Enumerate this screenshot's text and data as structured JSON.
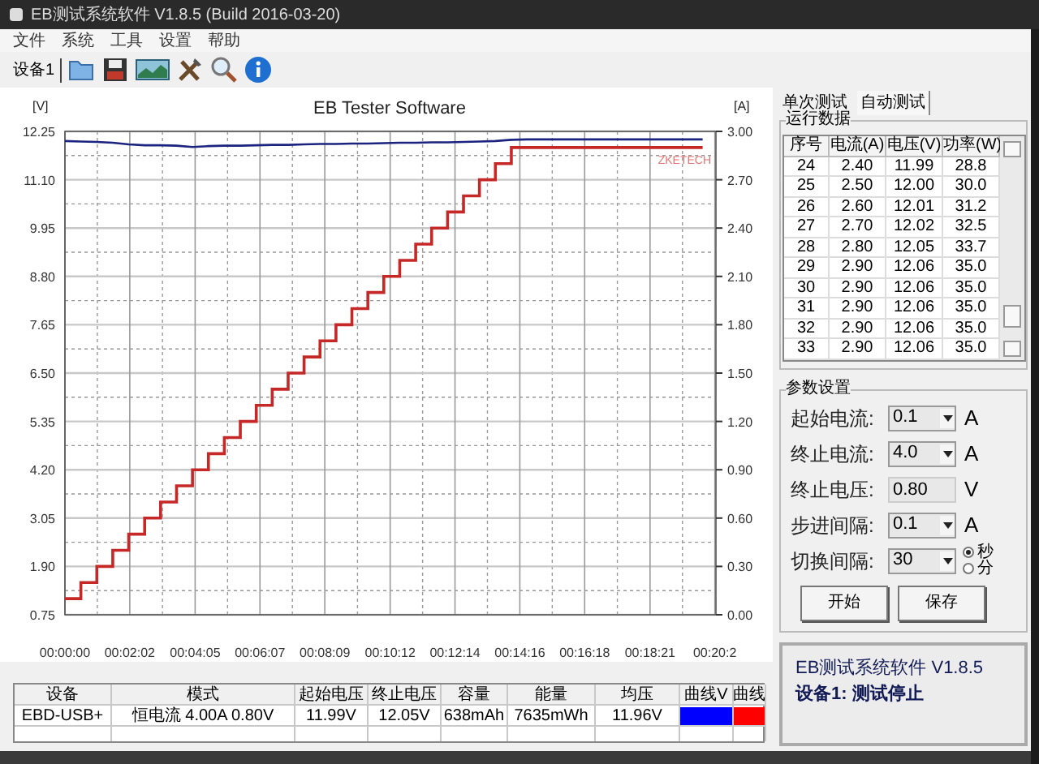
{
  "window": {
    "title": "EB测试系统软件 V1.8.5 (Build 2016-03-20)"
  },
  "menu": [
    "文件",
    "系统",
    "工具",
    "设置",
    "帮助"
  ],
  "toolbar": {
    "device_label": "设备1"
  },
  "chart": {
    "chart_data": {
      "type": "line",
      "title": "EB Tester Software",
      "ylabel": "[V]",
      "y2label": "[A]",
      "grid": true,
      "xlim": [
        0,
        1225
      ],
      "ylim": [
        0.75,
        12.25
      ],
      "y2lim": [
        0,
        3
      ],
      "x": [
        0,
        30,
        30,
        60,
        60,
        90,
        90,
        120,
        120,
        150,
        150,
        180,
        180,
        210,
        210,
        240,
        240,
        270,
        270,
        300,
        300,
        330,
        330,
        360,
        360,
        390,
        390,
        420,
        420,
        450,
        450,
        480,
        480,
        510,
        510,
        540,
        540,
        570,
        570,
        600,
        600,
        630,
        630,
        660,
        660,
        690,
        690,
        720,
        720,
        750,
        750,
        780,
        780,
        810,
        810,
        840,
        840,
        870,
        870,
        900,
        900,
        930,
        930,
        960,
        960,
        990,
        990,
        1020,
        1020,
        1050,
        1050,
        1080,
        1080,
        1110,
        1110,
        1140,
        1140,
        1170,
        1170,
        1200,
        1200
      ],
      "series": [
        {
          "color": "#1a237e",
          "values": [
            12.02,
            12.01,
            12.01,
            12.0,
            12.0,
            11.98,
            11.98,
            11.94,
            11.94,
            11.92,
            11.92,
            11.92,
            11.92,
            11.91,
            11.91,
            11.88,
            11.88,
            11.9,
            11.9,
            11.91,
            11.91,
            11.91,
            11.91,
            11.92,
            11.92,
            11.93,
            11.93,
            11.93,
            11.93,
            11.94,
            11.94,
            11.95,
            11.95,
            11.95,
            11.95,
            11.96,
            11.96,
            11.96,
            11.96,
            11.97,
            11.97,
            11.98,
            11.98,
            11.98,
            11.98,
            11.99,
            11.99,
            11.99,
            11.99,
            12.0,
            12.0,
            12.01,
            12.01,
            12.02,
            12.02,
            12.05,
            12.05,
            12.06,
            12.06,
            12.06,
            12.06,
            12.06,
            12.06,
            12.06,
            12.06,
            12.06,
            12.06,
            12.06,
            12.06,
            12.06,
            12.06,
            12.06,
            12.06,
            12.06,
            12.06,
            12.06,
            12.06,
            12.06,
            12.06,
            12.06,
            12.06
          ]
        },
        {
          "color": "#c62828",
          "axis": "y2",
          "values": [
            0.1,
            0.1,
            0.2,
            0.2,
            0.3,
            0.3,
            0.4,
            0.4,
            0.5,
            0.5,
            0.6,
            0.6,
            0.7,
            0.7,
            0.8,
            0.8,
            0.9,
            0.9,
            1.0,
            1.0,
            1.1,
            1.1,
            1.2,
            1.2,
            1.3,
            1.3,
            1.4,
            1.4,
            1.5,
            1.5,
            1.6,
            1.6,
            1.7,
            1.7,
            1.8,
            1.8,
            1.9,
            1.9,
            2.0,
            2.0,
            2.1,
            2.1,
            2.2,
            2.2,
            2.3,
            2.3,
            2.4,
            2.4,
            2.5,
            2.5,
            2.6,
            2.6,
            2.7,
            2.7,
            2.8,
            2.8,
            2.9,
            2.9,
            2.9,
            2.9,
            2.9,
            2.9,
            2.9,
            2.9,
            2.9,
            2.9,
            2.9,
            2.9,
            2.9,
            2.9,
            2.9,
            2.9,
            2.9,
            2.9,
            2.9,
            2.9,
            2.9,
            2.9,
            2.9,
            2.9,
            2.9
          ]
        }
      ],
      "xticks": [
        {
          "value": 0,
          "label": "00:00:00"
        },
        {
          "value": 122,
          "label": "00:02:02"
        },
        {
          "value": 245,
          "label": "00:04:05"
        },
        {
          "value": 367,
          "label": "00:06:07"
        },
        {
          "value": 489,
          "label": "00:08:09"
        },
        {
          "value": 612,
          "label": "00:10:12"
        },
        {
          "value": 734,
          "label": "00:12:14"
        },
        {
          "value": 856,
          "label": "00:14:16"
        },
        {
          "value": 978,
          "label": "00:16:18"
        },
        {
          "value": 1101,
          "label": "00:18:21"
        },
        {
          "value": 1223,
          "label": "00:20:2"
        }
      ],
      "yticks": [
        {
          "value": 0.75,
          "label": "0.75"
        },
        {
          "value": 1.9,
          "label": "1.90"
        },
        {
          "value": 3.05,
          "label": "3.05"
        },
        {
          "value": 4.2,
          "label": "4.20"
        },
        {
          "value": 5.35,
          "label": "5.35"
        },
        {
          "value": 6.5,
          "label": "6.50"
        },
        {
          "value": 7.65,
          "label": "7.65"
        },
        {
          "value": 8.8,
          "label": "8.80"
        },
        {
          "value": 9.95,
          "label": "9.95"
        },
        {
          "value": 11.1,
          "label": "11.10"
        },
        {
          "value": 12.25,
          "label": "12.25"
        }
      ],
      "y2ticks": [
        {
          "value": 0,
          "label": "0.00"
        },
        {
          "value": 0.3,
          "label": "0.30"
        },
        {
          "value": 0.6,
          "label": "0.60"
        },
        {
          "value": 0.9,
          "label": "0.90"
        },
        {
          "value": 1.2,
          "label": "1.20"
        },
        {
          "value": 1.5,
          "label": "1.50"
        },
        {
          "value": 1.8,
          "label": "1.80"
        },
        {
          "value": 2.1,
          "label": "2.10"
        },
        {
          "value": 2.4,
          "label": "2.40"
        },
        {
          "value": 2.7,
          "label": "2.70"
        },
        {
          "value": 3.0,
          "label": "3.00"
        }
      ],
      "annotations": [
        "ZKETECH"
      ]
    }
  },
  "results": {
    "columns": [
      "设备",
      "模式",
      "起始电压",
      "终止电压",
      "容量",
      "能量",
      "均压",
      "曲线V",
      "曲线"
    ],
    "rows": [
      {
        "device": "EBD-USB+",
        "mode": "恒电流  4.00A  0.80V",
        "start_voltage": "11.99V",
        "end_voltage": "12.05V",
        "capacity": "638mAh",
        "energy": "7635mWh",
        "avg_voltage": "11.96V",
        "curves": [
          {
            "color": "#0000ff"
          },
          {
            "color": "#ff0000"
          }
        ]
      }
    ]
  },
  "tabs": [
    {
      "label": "单次测试",
      "selected": false
    },
    {
      "label": "自动测试",
      "selected": true
    }
  ],
  "run_data": {
    "title": "运行数据",
    "columns": [
      "序号",
      "电流(A)",
      "电压(V)",
      "功率(W)"
    ],
    "rows": [
      [
        "24",
        "2.40",
        "11.99",
        "28.8"
      ],
      [
        "25",
        "2.50",
        "12.00",
        "30.0"
      ],
      [
        "26",
        "2.60",
        "12.01",
        "31.2"
      ],
      [
        "27",
        "2.70",
        "12.02",
        "32.5"
      ],
      [
        "28",
        "2.80",
        "12.05",
        "33.7"
      ],
      [
        "29",
        "2.90",
        "12.06",
        "35.0"
      ],
      [
        "30",
        "2.90",
        "12.06",
        "35.0"
      ],
      [
        "31",
        "2.90",
        "12.06",
        "35.0"
      ],
      [
        "32",
        "2.90",
        "12.06",
        "35.0"
      ],
      [
        "33",
        "2.90",
        "12.06",
        "35.0"
      ]
    ]
  },
  "params": {
    "title": "参数设置",
    "fields": [
      {
        "kind": "dropdown",
        "label": "起始电流:",
        "value": "0.1",
        "unit": "A"
      },
      {
        "kind": "dropdown",
        "label": "终止电流:",
        "value": "4.0",
        "unit": "A"
      },
      {
        "kind": "text",
        "label": "终止电压:",
        "value": "0.80",
        "unit": "V"
      },
      {
        "kind": "dropdown",
        "label": "步进间隔:",
        "value": "0.1",
        "unit": "A"
      },
      {
        "kind": "dropdown",
        "label": "切换间隔:",
        "value": "30"
      }
    ],
    "time_units": [
      {
        "label": "秒",
        "selected": true
      },
      {
        "label": "分",
        "selected": false
      }
    ],
    "buttons": [
      "开始",
      "保存"
    ]
  },
  "status": {
    "title": "EB测试系统软件 V1.8.5",
    "message": "设备1: 测试停止"
  }
}
